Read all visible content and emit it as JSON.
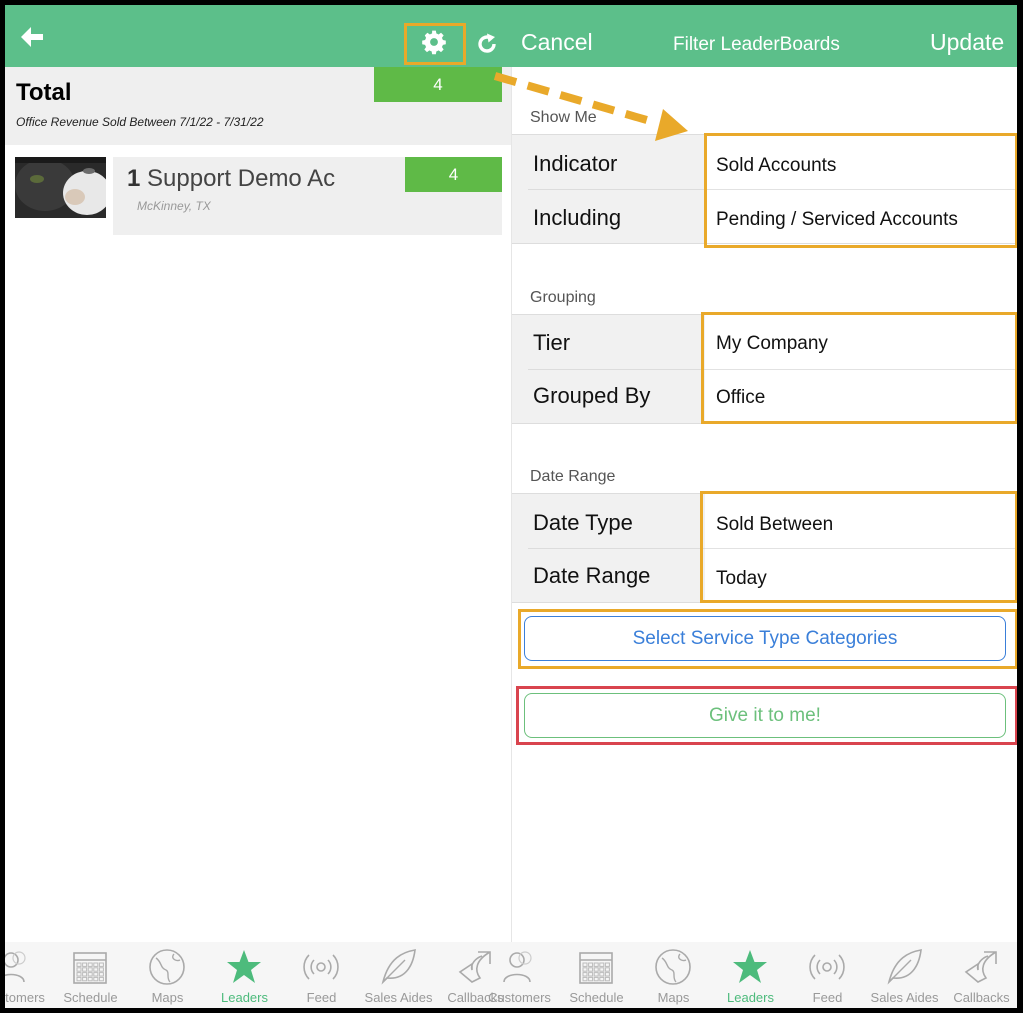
{
  "colors": {
    "header": "#5cbf8a",
    "badge_green": "#5fba47",
    "highlight_orange": "#e9a92a",
    "highlight_red": "#d9444e",
    "link_blue": "#3a7fd9",
    "cta_green": "#6cc07c"
  },
  "left": {
    "header": {
      "back_icon": "arrow-left-icon",
      "settings_icon": "gear-icon",
      "refresh_icon": "refresh-icon"
    },
    "total": {
      "title": "Total",
      "subtitle": "Office Revenue Sold Between 7/1/22 - 7/31/22",
      "count": "4"
    },
    "leaders": [
      {
        "rank": "1",
        "name": "Support Demo Ac",
        "location": "McKinney, TX",
        "count": "4"
      }
    ]
  },
  "right": {
    "nav": {
      "cancel": "Cancel",
      "title": "Filter LeaderBoards",
      "update": "Update"
    },
    "sections": {
      "show_me": {
        "label": "Show Me",
        "rows": [
          {
            "label": "Indicator",
            "value": "Sold Accounts"
          },
          {
            "label": "Including",
            "value": "Pending / Serviced Accounts"
          }
        ]
      },
      "grouping": {
        "label": "Grouping",
        "rows": [
          {
            "label": "Tier",
            "value": "My Company"
          },
          {
            "label": "Grouped By",
            "value": "Office"
          }
        ]
      },
      "date_range": {
        "label": "Date Range",
        "rows": [
          {
            "label": "Date Type",
            "value": "Sold Between"
          },
          {
            "label": "Date Range",
            "value": "Today"
          }
        ]
      }
    },
    "service_button": "Select Service Type Categories",
    "give_button": "Give it to me!"
  },
  "tabs": [
    {
      "label": "Customers",
      "icon": "customers-icon"
    },
    {
      "label": "Schedule",
      "icon": "calendar-icon"
    },
    {
      "label": "Maps",
      "icon": "globe-icon"
    },
    {
      "label": "Leaders",
      "icon": "star-icon",
      "active": true
    },
    {
      "label": "Feed",
      "icon": "broadcast-icon"
    },
    {
      "label": "Sales Aides",
      "icon": "leaf-icon"
    },
    {
      "label": "Callbacks",
      "icon": "callback-arrow-icon"
    }
  ]
}
